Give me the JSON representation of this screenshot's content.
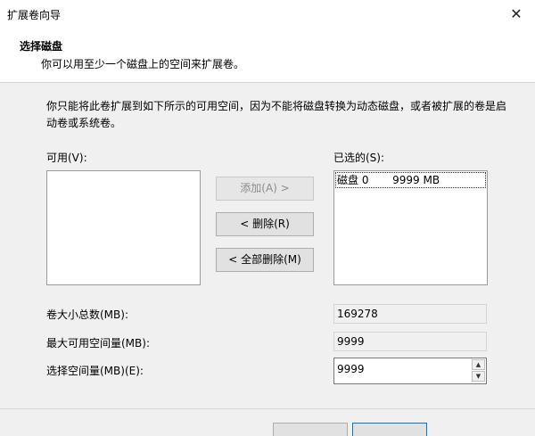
{
  "window": {
    "title": "扩展卷向导",
    "close_glyph": "✕"
  },
  "header": {
    "title": "选择磁盘",
    "subtitle": "你可以用至少一个磁盘上的空间来扩展卷。"
  },
  "description": "你只能将此卷扩展到如下所示的可用空间，因为不能将磁盘转换为动态磁盘，或者被扩展的卷是启动卷或系统卷。",
  "available": {
    "label": "可用(V):",
    "items": []
  },
  "selected": {
    "label": "已选的(S):",
    "items": [
      {
        "disk": "磁盘 0",
        "size": "9999 MB"
      }
    ]
  },
  "buttons": {
    "add": "添加(A) >",
    "remove": "< 删除(R)",
    "remove_all": "< 全部删除(M)"
  },
  "fields": {
    "total_label": "卷大小总数(MB):",
    "total_value": "169278",
    "max_label": "最大可用空间量(MB):",
    "max_value": "9999",
    "select_label": "选择空间量(MB)(E):",
    "select_value": "9999"
  },
  "icons": {
    "close": "close-icon",
    "spin_up": "chevron-up-icon",
    "spin_down": "chevron-down-icon"
  }
}
